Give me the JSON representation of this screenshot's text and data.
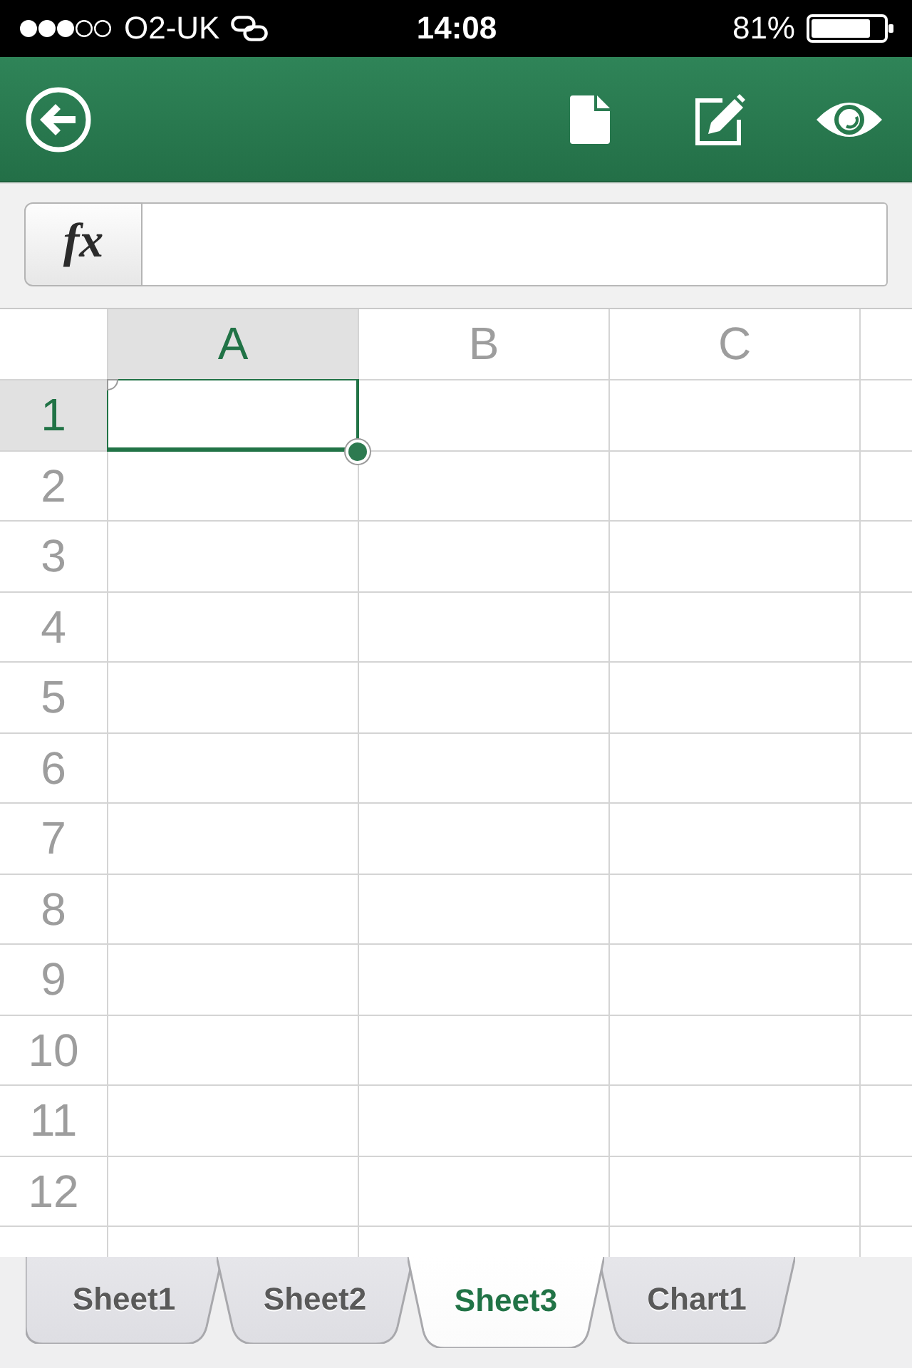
{
  "status_bar": {
    "carrier": "O2-UK",
    "time": "14:08",
    "battery": "81%"
  },
  "formula_bar": {
    "function_button": "fx"
  },
  "sheet": {
    "columns": [
      {
        "label": "A",
        "selected": true
      },
      {
        "label": "B",
        "selected": false
      },
      {
        "label": "C",
        "selected": false
      },
      {
        "selected": false
      }
    ],
    "rows": [
      {
        "label": "1",
        "selected": true
      },
      {
        "label": "2",
        "selected": false
      },
      {
        "label": "3",
        "selected": false
      },
      {
        "label": "4",
        "selected": false
      },
      {
        "label": "5",
        "selected": false
      },
      {
        "label": "6",
        "selected": false
      },
      {
        "label": "7",
        "selected": false
      },
      {
        "label": "8",
        "selected": false
      },
      {
        "label": "9",
        "selected": false
      },
      {
        "label": "10",
        "selected": false
      },
      {
        "label": "11",
        "selected": false
      },
      {
        "label": "12",
        "selected": false
      },
      {
        "selected": false
      }
    ]
  },
  "sheet_tabs": [
    {
      "label": "Sheet1",
      "selected": false
    },
    {
      "label": "Sheet2",
      "selected": false
    },
    {
      "label": "Sheet3",
      "selected": true
    },
    {
      "label": "Chart1",
      "selected": false
    }
  ]
}
